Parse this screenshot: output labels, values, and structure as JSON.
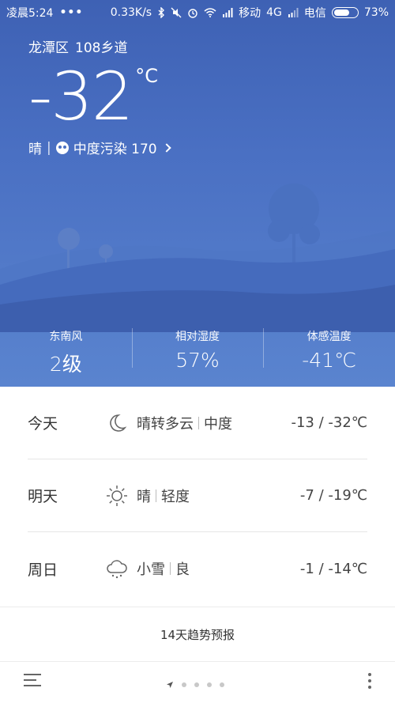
{
  "status_bar": {
    "time": "凌晨5:24",
    "dots": "•••",
    "net_speed": "0.33K/s",
    "carrier1": "移动",
    "network": "4G",
    "carrier2": "电信",
    "battery_percent": "73%",
    "battery_level": 0.73
  },
  "location": {
    "district": "龙潭区",
    "road": "108乡道"
  },
  "current": {
    "temperature": "-32",
    "unit": "°C",
    "condition": "晴",
    "separator": "|",
    "air_quality": "中度污染 170",
    "icon": "skull-icon"
  },
  "metrics": [
    {
      "label": "东南风",
      "value": "2级"
    },
    {
      "label": "相对湿度",
      "value": "57%"
    },
    {
      "label": "体感温度",
      "value": "-41℃"
    }
  ],
  "forecast": [
    {
      "day": "今天",
      "icon": "moon-icon",
      "weather": "晴转多云",
      "air": "中度",
      "range": "-13 / -32℃"
    },
    {
      "day": "明天",
      "icon": "sun-icon",
      "weather": "晴",
      "air": "轻度",
      "range": "-7 / -19℃"
    },
    {
      "day": "周日",
      "icon": "snow-cloud-icon",
      "weather": "小雪",
      "air": "良",
      "range": "-1 / -14℃"
    }
  ],
  "trend_label": "14天趋势预报",
  "colors": {
    "sky_top": "#3e61b4",
    "sky_bottom": "#5a84cf",
    "hill_dark": "#3d5fae",
    "hill_mid": "#4a6fbf"
  }
}
